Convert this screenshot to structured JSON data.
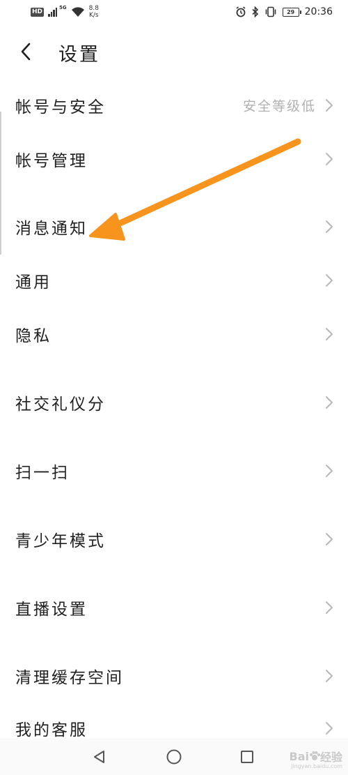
{
  "status_bar": {
    "hd_label": "HD",
    "network_gen": "5G",
    "speed_value": "8.8",
    "speed_unit": "K/s",
    "battery_level": "29",
    "time": "20:36"
  },
  "header": {
    "title": "设置"
  },
  "settings": [
    {
      "label": "帐号与安全",
      "value": "安全等级低"
    },
    {
      "label": "帐号管理",
      "value": ""
    },
    {
      "label": "消息通知",
      "value": ""
    },
    {
      "label": "通用",
      "value": ""
    },
    {
      "label": "隐私",
      "value": ""
    },
    {
      "label": "社交礼仪分",
      "value": ""
    },
    {
      "label": "扫一扫",
      "value": ""
    },
    {
      "label": "青少年模式",
      "value": ""
    },
    {
      "label": "直播设置",
      "value": ""
    },
    {
      "label": "清理缓存空间",
      "value": ""
    },
    {
      "label": "我的客服",
      "value": ""
    }
  ],
  "colors": {
    "annotation_arrow": "#f7941d",
    "chevron": "#b8b8b8",
    "secondary_text": "#b0b0b0"
  },
  "watermark": {
    "brand": "Bai",
    "brand_suffix": "经验",
    "url": "jingyan.baidu.com"
  }
}
